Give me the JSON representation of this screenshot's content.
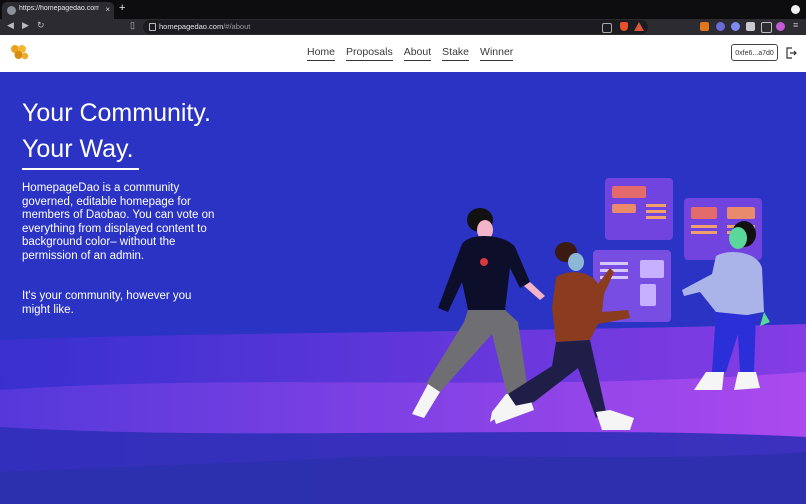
{
  "browser": {
    "tab_title": "https://homepagedao.com/#/about",
    "url_host": "homepagedao.com",
    "url_path": "/#/about",
    "new_tab": "+",
    "tab_close": "×"
  },
  "nav": {
    "items": [
      "Home",
      "Proposals",
      "About",
      "Stake",
      "Winner"
    ],
    "wallet": "0xfe6...a7d0"
  },
  "hero": {
    "headline_line1": "Your Community.",
    "headline_line2": "Your Way.",
    "description": "HomepageDao is a community governed, editable homepage for members of Daobao. You can vote on everything from displayed content to background color– without the permission of an admin.",
    "tagline": "It's your community, however you might like."
  },
  "colors": {
    "hero_bg": "#2a33c4",
    "accent_purple": "#8a3ee0",
    "header_bg": "#ffffff"
  },
  "icons": [
    "favicon-icon",
    "back-icon",
    "forward-icon",
    "reload-icon",
    "bookmark-icon",
    "lock-icon",
    "brave-shield-icon",
    "brave-rewards-icon",
    "metamask-icon",
    "extensions-icon",
    "logo-icon",
    "logout-icon"
  ]
}
